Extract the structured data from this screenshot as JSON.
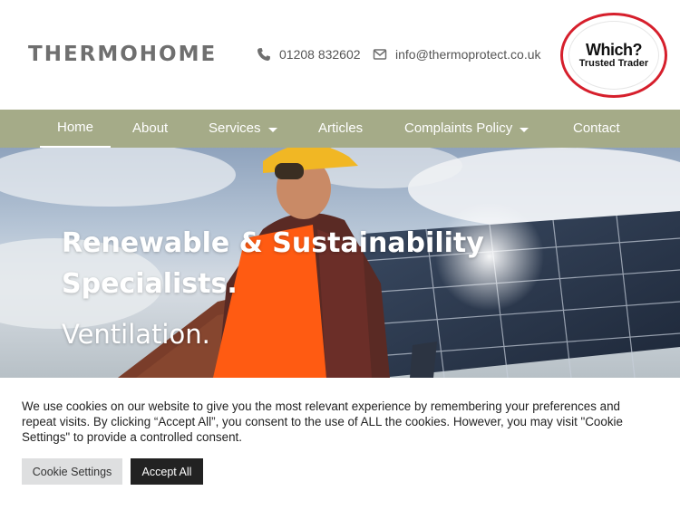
{
  "header": {
    "logo_text": "THERMOHOME",
    "phone": "01208 832602",
    "email": "info@thermoprotect.co.uk",
    "badge": {
      "title": "Which?",
      "subtitle": "Trusted Trader"
    }
  },
  "nav": {
    "items": [
      {
        "label": "Home",
        "active": true
      },
      {
        "label": "About"
      },
      {
        "label": "Services",
        "dropdown": true
      },
      {
        "label": "Articles"
      },
      {
        "label": "Complaints Policy",
        "dropdown": true
      },
      {
        "label": "Contact"
      }
    ]
  },
  "hero": {
    "title": "Renewable & Sustainability Specialists.",
    "subtitle": "Ventilation."
  },
  "cookie": {
    "text": "We use cookies on our website to give you the most relevant experience by remembering your preferences and repeat visits. By clicking “Accept All”, you consent to the use of ALL the cookies. However, you may visit \"Cookie Settings\" to provide a controlled consent.",
    "settings_label": "Cookie Settings",
    "accept_label": "Accept All"
  },
  "colors": {
    "nav_background": "#a5ab88",
    "badge_ring": "#d61f2c",
    "accept_button": "#222222"
  },
  "icons": [
    "phone-icon",
    "envelope-icon",
    "chevron-down-icon"
  ]
}
